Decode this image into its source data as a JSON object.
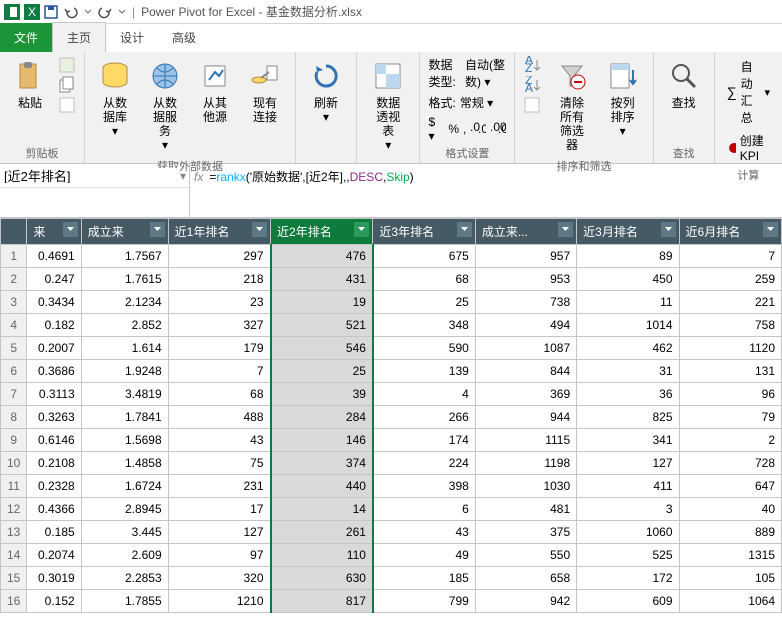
{
  "titlebar": {
    "app_name": "Power Pivot for Excel",
    "doc_name": "基金数据分析.xlsx"
  },
  "tabs": {
    "file": "文件",
    "home": "主页",
    "design": "设计",
    "advanced": "高级"
  },
  "ribbon": {
    "clipboard": {
      "paste": "粘贴",
      "label": "剪贴板"
    },
    "external": {
      "db": "从数据库",
      "service": "从数据服务",
      "other": "从其他源",
      "existing": "现有连接",
      "label": "获取外部数据"
    },
    "refresh": "刷新",
    "pivot": "数据透视表",
    "format": {
      "datatype": "数据类型:",
      "datatype_val": "自动(整数)",
      "format": "格式:",
      "format_val": "常规",
      "label": "格式设置"
    },
    "sort": {
      "clear": "清除所有筛选器",
      "bycolumn": "按列排序",
      "label": "排序和筛选"
    },
    "find": {
      "find": "查找",
      "label": "查找"
    },
    "calc": {
      "autosum": "自动汇总",
      "kpi": "创建 KPI",
      "label": "计算"
    }
  },
  "formula": {
    "cell_name": "[近2年排名]",
    "text_prefix": "=",
    "fn": "rankx",
    "args1": "('原始数据',[近2年],,",
    "desc": "DESC",
    "comma": ",",
    "skip": "Skip",
    "close": ")"
  },
  "columns": [
    "来",
    "成立来",
    "近1年排名",
    "近2年排名",
    "近3年排名",
    "成立来...",
    "近3月排名",
    "近6月排名"
  ],
  "chart_data": {
    "type": "table",
    "rows": [
      {
        "n": 1,
        "c1": "0.4691",
        "c2": "1.7567",
        "c3": 297,
        "c4": 476,
        "c5": 675,
        "c6": 957,
        "c7": 89,
        "c8": 7
      },
      {
        "n": 2,
        "c1": "0.247",
        "c2": "1.7615",
        "c3": 218,
        "c4": 431,
        "c5": 68,
        "c6": 953,
        "c7": 450,
        "c8": 259
      },
      {
        "n": 3,
        "c1": "0.3434",
        "c2": "2.1234",
        "c3": 23,
        "c4": 19,
        "c5": 25,
        "c6": 738,
        "c7": 11,
        "c8": 221
      },
      {
        "n": 4,
        "c1": "0.182",
        "c2": "2.852",
        "c3": 327,
        "c4": 521,
        "c5": 348,
        "c6": 494,
        "c7": 1014,
        "c8": 758
      },
      {
        "n": 5,
        "c1": "0.2007",
        "c2": "1.614",
        "c3": 179,
        "c4": 546,
        "c5": 590,
        "c6": 1087,
        "c7": 462,
        "c8": 1120
      },
      {
        "n": 6,
        "c1": "0.3686",
        "c2": "1.9248",
        "c3": 7,
        "c4": 25,
        "c5": 139,
        "c6": 844,
        "c7": 31,
        "c8": 131
      },
      {
        "n": 7,
        "c1": "0.3113",
        "c2": "3.4819",
        "c3": 68,
        "c4": 39,
        "c5": 4,
        "c6": 369,
        "c7": 36,
        "c8": 96
      },
      {
        "n": 8,
        "c1": "0.3263",
        "c2": "1.7841",
        "c3": 488,
        "c4": 284,
        "c5": 266,
        "c6": 944,
        "c7": 825,
        "c8": 79
      },
      {
        "n": 9,
        "c1": "0.6146",
        "c2": "1.5698",
        "c3": 43,
        "c4": 146,
        "c5": 174,
        "c6": 1115,
        "c7": 341,
        "c8": 2
      },
      {
        "n": 10,
        "c1": "0.2108",
        "c2": "1.4858",
        "c3": 75,
        "c4": 374,
        "c5": 224,
        "c6": 1198,
        "c7": 127,
        "c8": 728
      },
      {
        "n": 11,
        "c1": "0.2328",
        "c2": "1.6724",
        "c3": 231,
        "c4": 440,
        "c5": 398,
        "c6": 1030,
        "c7": 411,
        "c8": 647
      },
      {
        "n": 12,
        "c1": "0.4366",
        "c2": "2.8945",
        "c3": 17,
        "c4": 14,
        "c5": 6,
        "c6": 481,
        "c7": 3,
        "c8": 40
      },
      {
        "n": 13,
        "c1": "0.185",
        "c2": "3.445",
        "c3": 127,
        "c4": 261,
        "c5": 43,
        "c6": 375,
        "c7": 1060,
        "c8": 889
      },
      {
        "n": 14,
        "c1": "0.2074",
        "c2": "2.609",
        "c3": 97,
        "c4": 110,
        "c5": 49,
        "c6": 550,
        "c7": 525,
        "c8": 1315
      },
      {
        "n": 15,
        "c1": "0.3019",
        "c2": "2.2853",
        "c3": 320,
        "c4": 630,
        "c5": 185,
        "c6": 658,
        "c7": 172,
        "c8": 105
      },
      {
        "n": 16,
        "c1": "0.152",
        "c2": "1.7855",
        "c3": 1210,
        "c4": 817,
        "c5": 799,
        "c6": 942,
        "c7": 609,
        "c8": 1064
      }
    ]
  }
}
